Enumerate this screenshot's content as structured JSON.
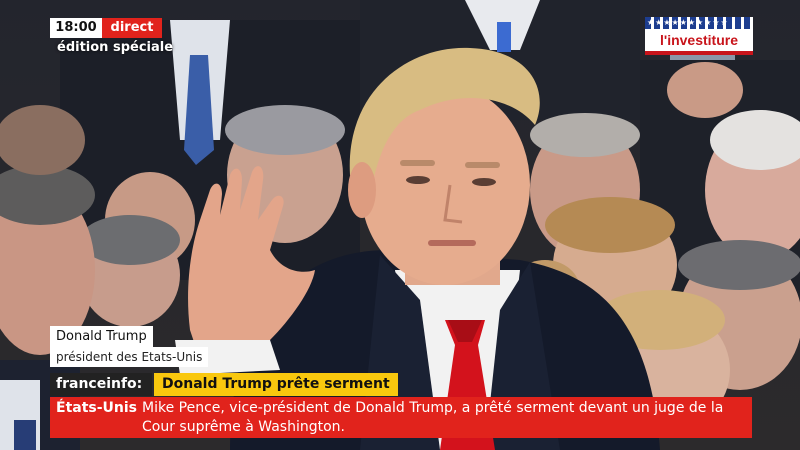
{
  "broadcast": {
    "time": "18:00",
    "live_label": "direct",
    "program": "édition spéciale",
    "event_badge": "l'investiture"
  },
  "lower_third": {
    "name": "Donald Trump",
    "role": "président des Etats-Unis"
  },
  "news_band": {
    "channel": "franceinfo:",
    "headline": "Donald Trump prête serment",
    "region": "États-Unis",
    "ticker_text": "Mike Pence, vice-président de Donald Trump, a prêté serment devant un juge de la Cour suprême à Washington."
  },
  "colors": {
    "live_red": "#e1231c",
    "headline_yellow": "#f9c80e",
    "badge_blue": "#1d3d8f"
  }
}
